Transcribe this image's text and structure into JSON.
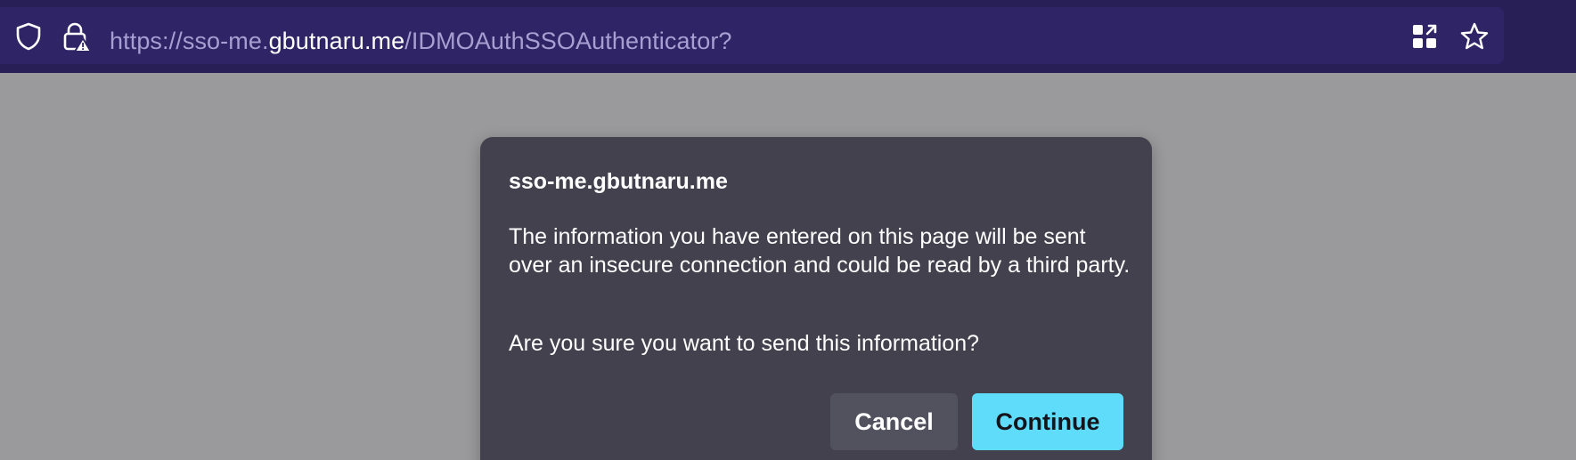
{
  "browser": {
    "url": {
      "scheme_prefix": "https://sso-me.",
      "host": "gbutnaru.me",
      "path": "/IDMOAuthSSOAuthenticator?"
    },
    "icons": {
      "tracking_protection": "shield-icon",
      "connection_security": "insecure-lock-icon",
      "extensions": "extensions-grid-icon",
      "bookmark": "bookmark-star-icon"
    },
    "colors": {
      "toolbar": "#291f57",
      "urlbar": "#2f2566",
      "url_dim_text": "#a79fd1"
    }
  },
  "dialog": {
    "title": "sso-me.gbutnaru.me",
    "body": "The information you have entered on this page will be sent over an insecure connection and could be read by a third party.",
    "question": "Are you sure you want to send this information?",
    "cancel_label": "Cancel",
    "continue_label": "Continue",
    "colors": {
      "background": "#42414d",
      "cancel_button": "#52515e",
      "continue_button": "#5fdcfa"
    }
  }
}
